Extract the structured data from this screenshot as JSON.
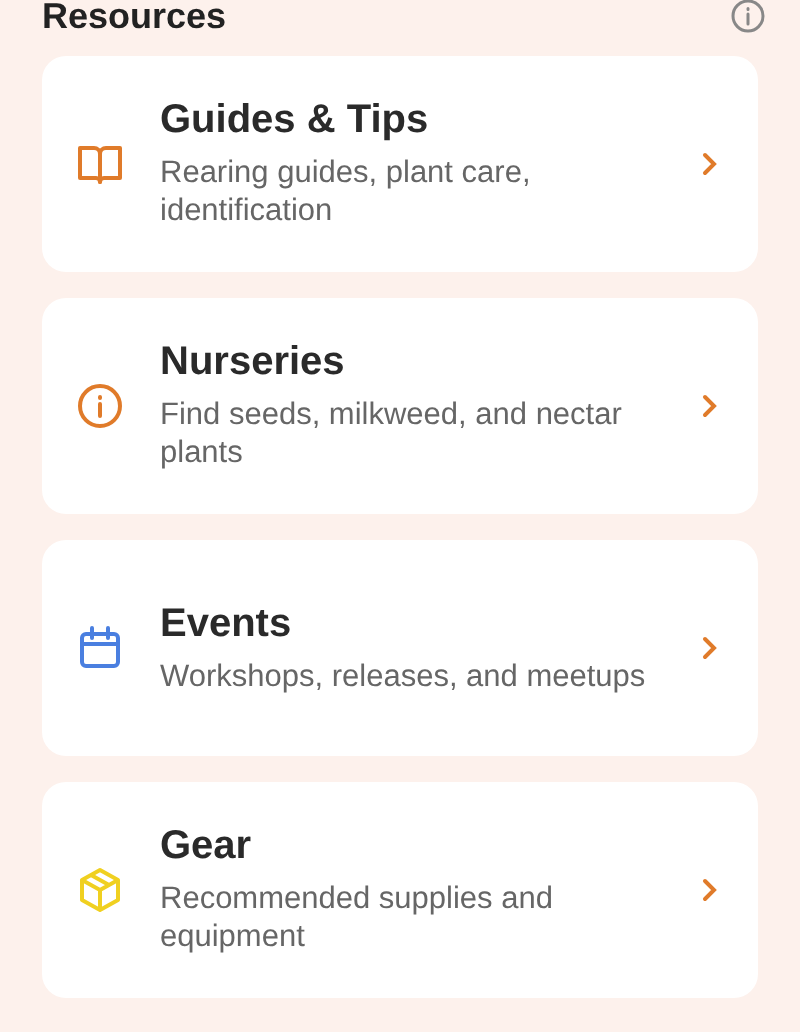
{
  "header": {
    "title": "Resources"
  },
  "items": [
    {
      "kind": "book",
      "color": "#e07b2a",
      "title": "Guides & Tips",
      "subtitle": "Rearing guides, plant care, identification"
    },
    {
      "kind": "info",
      "color": "#e07b2a",
      "title": "Nurseries",
      "subtitle": "Find seeds, milkweed, and nectar plants"
    },
    {
      "kind": "calendar",
      "color": "#4a7fe0",
      "title": "Events",
      "subtitle": "Workshops, releases, and meetups"
    },
    {
      "kind": "box",
      "color": "#f0d020",
      "title": "Gear",
      "subtitle": "Recommended supplies and equipment"
    }
  ]
}
